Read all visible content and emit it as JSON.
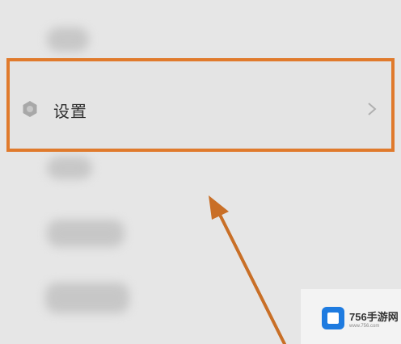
{
  "settings_row": {
    "label": "设置",
    "icon": "gear-icon",
    "chevron": "chevron-right-icon"
  },
  "highlight_color": "#e07a2c",
  "watermark": {
    "brand": "756手游网",
    "url": "www.756.com"
  }
}
